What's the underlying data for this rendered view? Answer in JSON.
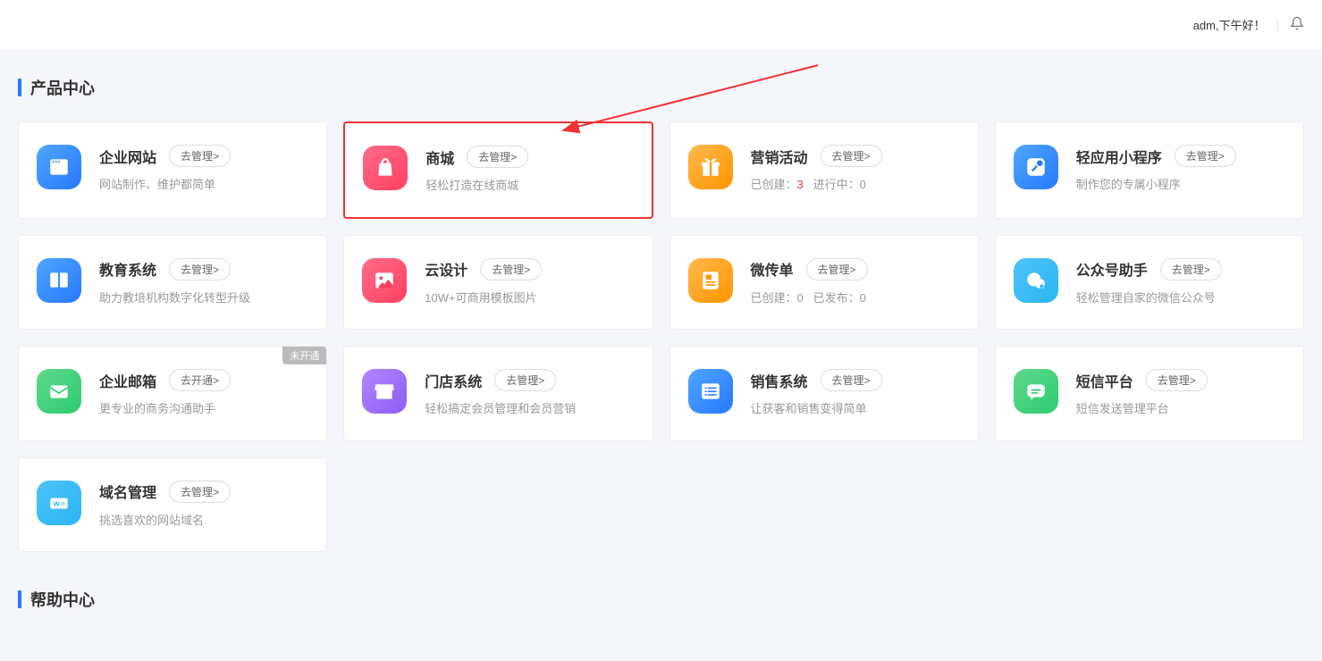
{
  "header": {
    "greeting": "adm,下午好！"
  },
  "section1_title": "产品中心",
  "section2_title": "帮助中心",
  "cards": [
    {
      "title": "企业网站",
      "btn": "去管理>",
      "desc": "网站制作、维护都简单",
      "icon": "window",
      "bg": "bg-blue"
    },
    {
      "title": "商城",
      "btn": "去管理>",
      "desc": "轻松打造在线商城",
      "icon": "bag",
      "bg": "bg-pink",
      "highlighted": true
    },
    {
      "title": "营销活动",
      "btn": "去管理>",
      "stats": {
        "label1": "已创建：",
        "val1": "3",
        "label2": "进行中：",
        "val2": "0"
      },
      "icon": "gift",
      "bg": "bg-orange"
    },
    {
      "title": "轻应用小程序",
      "btn": "去管理>",
      "desc": "制作您的专属小程序",
      "icon": "link",
      "bg": "bg-blue"
    },
    {
      "title": "教育系统",
      "btn": "去管理>",
      "desc": "助力教培机构数字化转型升级",
      "icon": "book",
      "bg": "bg-blue"
    },
    {
      "title": "云设计",
      "btn": "去管理>",
      "desc": "10W+可商用模板图片",
      "icon": "image",
      "bg": "bg-pink"
    },
    {
      "title": "微传单",
      "btn": "去管理>",
      "stats": {
        "label1": "已创建：",
        "val1": "0",
        "label2": "已发布：",
        "val2": "0"
      },
      "icon": "flyer",
      "bg": "bg-orange"
    },
    {
      "title": "公众号助手",
      "btn": "去管理>",
      "desc": "轻松管理自家的微信公众号",
      "icon": "wechat",
      "bg": "bg-cyan"
    },
    {
      "title": "企业邮箱",
      "btn": "去开通>",
      "desc": "更专业的商务沟通助手",
      "icon": "mail",
      "bg": "bg-green",
      "badge": "未开通"
    },
    {
      "title": "门店系统",
      "btn": "去管理>",
      "desc": "轻松搞定会员管理和会员营销",
      "icon": "store",
      "bg": "bg-purple"
    },
    {
      "title": "销售系统",
      "btn": "去管理>",
      "desc": "让获客和销售变得简单",
      "icon": "list",
      "bg": "bg-blue"
    },
    {
      "title": "短信平台",
      "btn": "去管理>",
      "desc": "短信发送管理平台",
      "icon": "message",
      "bg": "bg-green"
    },
    {
      "title": "域名管理",
      "btn": "去管理>",
      "desc": "挑选喜欢的网站域名",
      "icon": "domain",
      "bg": "bg-cyan"
    }
  ]
}
